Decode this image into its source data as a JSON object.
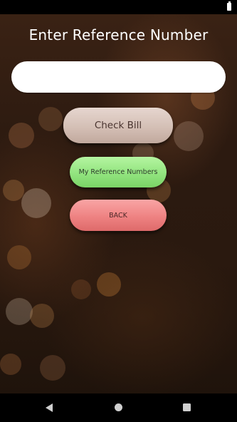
{
  "status_bar": {
    "battery_icon": "battery-icon"
  },
  "screen": {
    "title": "Enter Reference Number",
    "reference_input": {
      "value": "",
      "placeholder": ""
    },
    "buttons": {
      "check_bill": "Check Bill",
      "my_reference_numbers": "My Reference Numbers",
      "back": "BACK"
    }
  },
  "nav_bar": {
    "back_icon": "triangle-back-icon",
    "home_icon": "circle-home-icon",
    "recents_icon": "square-recents-icon"
  },
  "colors": {
    "check_bill_button": "#d6c3ba",
    "my_reference_numbers_button": "#94e681",
    "back_button": "#ef8585",
    "background": "#2c1a10"
  }
}
